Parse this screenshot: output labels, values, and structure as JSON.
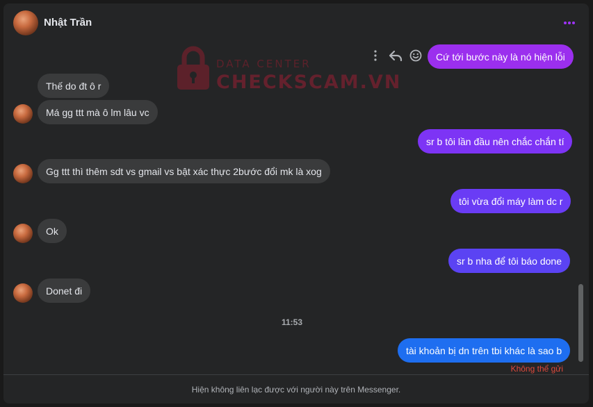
{
  "header": {
    "contact_name": "Nhật Trần"
  },
  "watermark": {
    "top_text": "DATA CENTER",
    "main_text": "CHECKSCAM.VN"
  },
  "messages": {
    "out1": "Cứ tới bước này là nó hiện lỗi",
    "in1": "Thế do đt ô r",
    "in2": "Má gg ttt mà ô lm lâu vc",
    "out2": "sr b tôi lần đầu nên chắc chắn tí",
    "in3": "Gg ttt thì thêm sdt vs gmail vs bật xác thực 2bước đổi mk là xog",
    "out3": "tôi vừa đổi máy làm dc r",
    "in4": "Ok",
    "out4": "sr b nha để tôi báo done",
    "in5": "Donet đi",
    "out5": "tài khoản bị dn trên tbi khác là sao b"
  },
  "timestamp": "11:53",
  "send_status": "Không thể gửi",
  "footer_notice": "Hiện không liên lạc được với người này trên Messenger.",
  "colors": {
    "accent": "#a033ff",
    "bubble_violet": "#9b2fee",
    "bubble_purple": "#7d34f5",
    "bubble_indigo": "#5b43f3",
    "bubble_blue": "#1e6ef0",
    "incoming": "#3a3b3c",
    "error": "#e0493c"
  },
  "icons": [
    "more-icon",
    "message-options-icon",
    "reply-icon",
    "emoji-icon",
    "watermark-lock-icon"
  ]
}
